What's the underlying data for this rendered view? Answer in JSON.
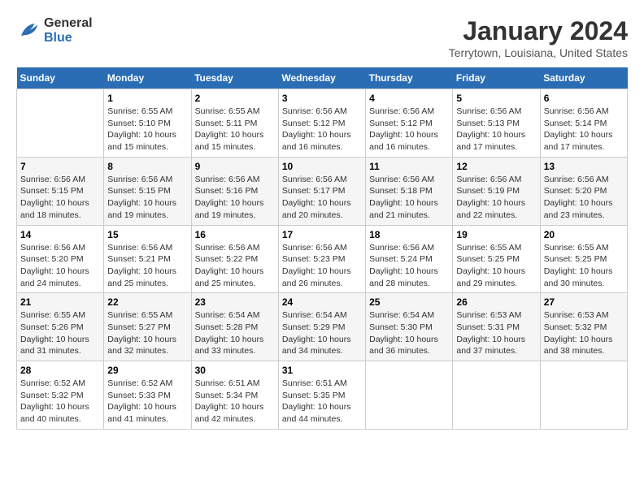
{
  "logo": {
    "text_general": "General",
    "text_blue": "Blue"
  },
  "title": "January 2024",
  "location": "Terrytown, Louisiana, United States",
  "days_of_week": [
    "Sunday",
    "Monday",
    "Tuesday",
    "Wednesday",
    "Thursday",
    "Friday",
    "Saturday"
  ],
  "weeks": [
    [
      {
        "day": "",
        "sunrise": "",
        "sunset": "",
        "daylight": ""
      },
      {
        "day": "1",
        "sunrise": "Sunrise: 6:55 AM",
        "sunset": "Sunset: 5:10 PM",
        "daylight": "Daylight: 10 hours and 15 minutes."
      },
      {
        "day": "2",
        "sunrise": "Sunrise: 6:55 AM",
        "sunset": "Sunset: 5:11 PM",
        "daylight": "Daylight: 10 hours and 15 minutes."
      },
      {
        "day": "3",
        "sunrise": "Sunrise: 6:56 AM",
        "sunset": "Sunset: 5:12 PM",
        "daylight": "Daylight: 10 hours and 16 minutes."
      },
      {
        "day": "4",
        "sunrise": "Sunrise: 6:56 AM",
        "sunset": "Sunset: 5:12 PM",
        "daylight": "Daylight: 10 hours and 16 minutes."
      },
      {
        "day": "5",
        "sunrise": "Sunrise: 6:56 AM",
        "sunset": "Sunset: 5:13 PM",
        "daylight": "Daylight: 10 hours and 17 minutes."
      },
      {
        "day": "6",
        "sunrise": "Sunrise: 6:56 AM",
        "sunset": "Sunset: 5:14 PM",
        "daylight": "Daylight: 10 hours and 17 minutes."
      }
    ],
    [
      {
        "day": "7",
        "sunrise": "Sunrise: 6:56 AM",
        "sunset": "Sunset: 5:15 PM",
        "daylight": "Daylight: 10 hours and 18 minutes."
      },
      {
        "day": "8",
        "sunrise": "Sunrise: 6:56 AM",
        "sunset": "Sunset: 5:15 PM",
        "daylight": "Daylight: 10 hours and 19 minutes."
      },
      {
        "day": "9",
        "sunrise": "Sunrise: 6:56 AM",
        "sunset": "Sunset: 5:16 PM",
        "daylight": "Daylight: 10 hours and 19 minutes."
      },
      {
        "day": "10",
        "sunrise": "Sunrise: 6:56 AM",
        "sunset": "Sunset: 5:17 PM",
        "daylight": "Daylight: 10 hours and 20 minutes."
      },
      {
        "day": "11",
        "sunrise": "Sunrise: 6:56 AM",
        "sunset": "Sunset: 5:18 PM",
        "daylight": "Daylight: 10 hours and 21 minutes."
      },
      {
        "day": "12",
        "sunrise": "Sunrise: 6:56 AM",
        "sunset": "Sunset: 5:19 PM",
        "daylight": "Daylight: 10 hours and 22 minutes."
      },
      {
        "day": "13",
        "sunrise": "Sunrise: 6:56 AM",
        "sunset": "Sunset: 5:20 PM",
        "daylight": "Daylight: 10 hours and 23 minutes."
      }
    ],
    [
      {
        "day": "14",
        "sunrise": "Sunrise: 6:56 AM",
        "sunset": "Sunset: 5:20 PM",
        "daylight": "Daylight: 10 hours and 24 minutes."
      },
      {
        "day": "15",
        "sunrise": "Sunrise: 6:56 AM",
        "sunset": "Sunset: 5:21 PM",
        "daylight": "Daylight: 10 hours and 25 minutes."
      },
      {
        "day": "16",
        "sunrise": "Sunrise: 6:56 AM",
        "sunset": "Sunset: 5:22 PM",
        "daylight": "Daylight: 10 hours and 25 minutes."
      },
      {
        "day": "17",
        "sunrise": "Sunrise: 6:56 AM",
        "sunset": "Sunset: 5:23 PM",
        "daylight": "Daylight: 10 hours and 26 minutes."
      },
      {
        "day": "18",
        "sunrise": "Sunrise: 6:56 AM",
        "sunset": "Sunset: 5:24 PM",
        "daylight": "Daylight: 10 hours and 28 minutes."
      },
      {
        "day": "19",
        "sunrise": "Sunrise: 6:55 AM",
        "sunset": "Sunset: 5:25 PM",
        "daylight": "Daylight: 10 hours and 29 minutes."
      },
      {
        "day": "20",
        "sunrise": "Sunrise: 6:55 AM",
        "sunset": "Sunset: 5:25 PM",
        "daylight": "Daylight: 10 hours and 30 minutes."
      }
    ],
    [
      {
        "day": "21",
        "sunrise": "Sunrise: 6:55 AM",
        "sunset": "Sunset: 5:26 PM",
        "daylight": "Daylight: 10 hours and 31 minutes."
      },
      {
        "day": "22",
        "sunrise": "Sunrise: 6:55 AM",
        "sunset": "Sunset: 5:27 PM",
        "daylight": "Daylight: 10 hours and 32 minutes."
      },
      {
        "day": "23",
        "sunrise": "Sunrise: 6:54 AM",
        "sunset": "Sunset: 5:28 PM",
        "daylight": "Daylight: 10 hours and 33 minutes."
      },
      {
        "day": "24",
        "sunrise": "Sunrise: 6:54 AM",
        "sunset": "Sunset: 5:29 PM",
        "daylight": "Daylight: 10 hours and 34 minutes."
      },
      {
        "day": "25",
        "sunrise": "Sunrise: 6:54 AM",
        "sunset": "Sunset: 5:30 PM",
        "daylight": "Daylight: 10 hours and 36 minutes."
      },
      {
        "day": "26",
        "sunrise": "Sunrise: 6:53 AM",
        "sunset": "Sunset: 5:31 PM",
        "daylight": "Daylight: 10 hours and 37 minutes."
      },
      {
        "day": "27",
        "sunrise": "Sunrise: 6:53 AM",
        "sunset": "Sunset: 5:32 PM",
        "daylight": "Daylight: 10 hours and 38 minutes."
      }
    ],
    [
      {
        "day": "28",
        "sunrise": "Sunrise: 6:52 AM",
        "sunset": "Sunset: 5:32 PM",
        "daylight": "Daylight: 10 hours and 40 minutes."
      },
      {
        "day": "29",
        "sunrise": "Sunrise: 6:52 AM",
        "sunset": "Sunset: 5:33 PM",
        "daylight": "Daylight: 10 hours and 41 minutes."
      },
      {
        "day": "30",
        "sunrise": "Sunrise: 6:51 AM",
        "sunset": "Sunset: 5:34 PM",
        "daylight": "Daylight: 10 hours and 42 minutes."
      },
      {
        "day": "31",
        "sunrise": "Sunrise: 6:51 AM",
        "sunset": "Sunset: 5:35 PM",
        "daylight": "Daylight: 10 hours and 44 minutes."
      },
      {
        "day": "",
        "sunrise": "",
        "sunset": "",
        "daylight": ""
      },
      {
        "day": "",
        "sunrise": "",
        "sunset": "",
        "daylight": ""
      },
      {
        "day": "",
        "sunrise": "",
        "sunset": "",
        "daylight": ""
      }
    ]
  ]
}
